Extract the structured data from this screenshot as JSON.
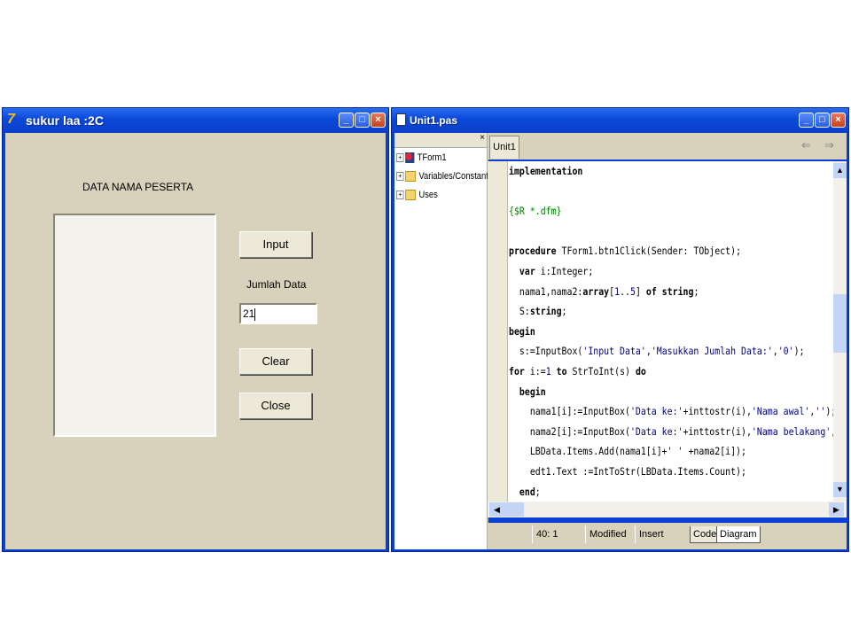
{
  "form_window": {
    "title": "sukur laa :2C",
    "heading": "DATA NAMA PESERTA",
    "buttons": {
      "input": "Input",
      "clear": "Clear",
      "close": "Close"
    },
    "jumlah_label": "Jumlah Data",
    "jumlah_value": "21"
  },
  "editor_window": {
    "title": "Unit1.pas",
    "tab": "Unit1",
    "tree": [
      "TForm1",
      "Variables/Constants",
      "Uses"
    ],
    "code_lines": [
      [
        {
          "t": "implementation",
          "c": "kw"
        }
      ],
      [],
      [
        {
          "t": "{$R *.dfm}",
          "c": "dir"
        }
      ],
      [],
      [
        {
          "t": "procedure",
          "c": "kw"
        },
        {
          "t": " TForm1.btn1Click(Sender: TObject);",
          "c": ""
        }
      ],
      [
        {
          "t": "  ",
          "c": ""
        },
        {
          "t": "var",
          "c": "kw"
        },
        {
          "t": " i:Integer;",
          "c": ""
        }
      ],
      [
        {
          "t": "  nama1,nama2:",
          "c": ""
        },
        {
          "t": "array",
          "c": "kw"
        },
        {
          "t": "[",
          "c": ""
        },
        {
          "t": "1",
          "c": "num"
        },
        {
          "t": "..",
          "c": ""
        },
        {
          "t": "5",
          "c": "num"
        },
        {
          "t": "] ",
          "c": ""
        },
        {
          "t": "of string",
          "c": "kw"
        },
        {
          "t": ";",
          "c": ""
        }
      ],
      [
        {
          "t": "  S:",
          "c": ""
        },
        {
          "t": "string",
          "c": "kw"
        },
        {
          "t": ";",
          "c": ""
        }
      ],
      [
        {
          "t": "begin",
          "c": "kw"
        }
      ],
      [
        {
          "t": "  s:=InputBox(",
          "c": ""
        },
        {
          "t": "'Input Data'",
          "c": "str"
        },
        {
          "t": ",",
          "c": ""
        },
        {
          "t": "'Masukkan Jumlah Data:'",
          "c": "str"
        },
        {
          "t": ",",
          "c": ""
        },
        {
          "t": "'0'",
          "c": "str"
        },
        {
          "t": ");",
          "c": ""
        }
      ],
      [
        {
          "t": "for",
          "c": "kw"
        },
        {
          "t": " i:=",
          "c": ""
        },
        {
          "t": "1",
          "c": "num"
        },
        {
          "t": " ",
          "c": ""
        },
        {
          "t": "to",
          "c": "kw"
        },
        {
          "t": " StrToInt(s) ",
          "c": ""
        },
        {
          "t": "do",
          "c": "kw"
        }
      ],
      [
        {
          "t": "  begin",
          "c": "kw"
        }
      ],
      [
        {
          "t": "    nama1[i]:=InputBox(",
          "c": ""
        },
        {
          "t": "'Data ke:'",
          "c": "str"
        },
        {
          "t": "+inttostr(i),",
          "c": ""
        },
        {
          "t": "'Nama awal'",
          "c": "str"
        },
        {
          "t": ",",
          "c": ""
        },
        {
          "t": "''",
          "c": "str"
        },
        {
          "t": ");",
          "c": ""
        }
      ],
      [
        {
          "t": "    nama2[i]:=InputBox(",
          "c": ""
        },
        {
          "t": "'Data ke:'",
          "c": "str"
        },
        {
          "t": "+inttostr(i),",
          "c": ""
        },
        {
          "t": "'Nama belakang'",
          "c": "str"
        },
        {
          "t": ",",
          "c": ""
        }
      ],
      [
        {
          "t": "    LBData.Items.Add(nama1[i]+",
          "c": ""
        },
        {
          "t": "' '",
          "c": "str"
        },
        {
          "t": " +nama2[i]);",
          "c": ""
        }
      ],
      [
        {
          "t": "    edt1.Text :=IntToStr(LBData.Items.Count);",
          "c": ""
        }
      ],
      [
        {
          "t": "  end",
          "c": "kw"
        },
        {
          "t": ";",
          "c": ""
        }
      ]
    ],
    "status": {
      "position": "40:  1",
      "modified": "Modified",
      "mode": "Insert"
    },
    "bottom_tabs": {
      "code": "Code",
      "diagram": "Diagram"
    }
  },
  "colors": {
    "titlebar": "#0a48d8",
    "form_bg": "#d8d2bc",
    "keyword": "#000000",
    "string": "#000080",
    "directive": "#008000"
  }
}
